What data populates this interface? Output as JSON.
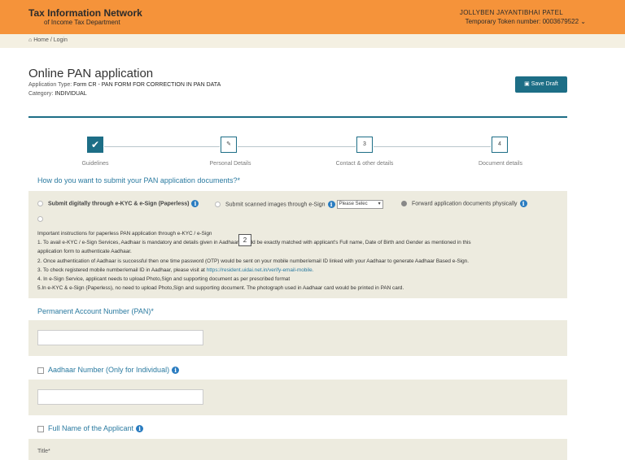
{
  "header": {
    "logo_line1": "Tax Information Network",
    "logo_line2": "of Income Tax Department",
    "user_name": "JOLLYBEN JAYANTIBHAI PATEL",
    "token_text": "Temporary Token number: 0003679522 ⌄",
    "bg_color": "#f5933a"
  },
  "breadcrumb": {
    "home": "Home",
    "separator": "/",
    "current": "Login",
    "home_icon": "home-icon"
  },
  "page": {
    "title": "Online PAN application",
    "app_type_label": "Application Type:",
    "app_type_value": "Form CR - PAN FORM FOR CORRECTION IN PAN DATA",
    "category_label": "Category:",
    "category_value": "INDIVIDUAL",
    "save_draft": "Save Draft",
    "accent": "#1d6e86"
  },
  "steps": [
    {
      "label": "Guidelines",
      "mark": "✔",
      "status": "done"
    },
    {
      "label": "Personal Details",
      "mark": "✎",
      "status": "current"
    },
    {
      "label": "Contact & other details",
      "mark": "3",
      "status": "pending"
    },
    {
      "label": "Document details",
      "mark": "4",
      "status": "pending"
    }
  ],
  "submission": {
    "question": "How do you want to submit your PAN application documents?*",
    "option_ekyc": "Submit digitally through e-KYC & e-Sign (Paperless)",
    "option_scanned": "Submit scanned images through e-Sign",
    "select_value": "Please Selec",
    "option_physical": "Forward application documents physically",
    "selected": "physical",
    "instructions_title": "Important instructions for paperless PAN application through e-KYC / e-Sign",
    "instructions": [
      "1. To avail e-KYC / e-Sign Services, Aadhaar is mandatory and details given in Aadhaar should be exactly matched with applicant's Full name, Date of Birth and Gender as mentioned in this",
      "application form to authenticate Aadhaar.",
      "2. Once authentication of Aadhaar is successful then one time password (OTP) would be sent on your mobile number/email ID linked with your Aadhaar to generate Aadhaar Based e-Sign.",
      "3. To check registered mobile number/email ID in Aadhaar, please visit at",
      "4. In e-Sign Service, applicant needs to upload Photo,Sign and supporting document as per prescribed format",
      "5.In e-KYC & e-Sign (Paperless), no need to upload Photo,Sign and supporting document. The photograph used in Aadhaar card would be printed in PAN card."
    ],
    "link_text": "https://resident.uidai.net.in/verify-email-mobile.",
    "tooltip_number": "2"
  },
  "fields": {
    "pan_label": "Permanent Account Number (PAN)*",
    "pan_value": "",
    "aadhaar_label": "Aadhaar Number (Only for Individual)",
    "aadhaar_value": "",
    "fullname_label": "Full Name of the Applicant",
    "title_label": "Title*"
  }
}
